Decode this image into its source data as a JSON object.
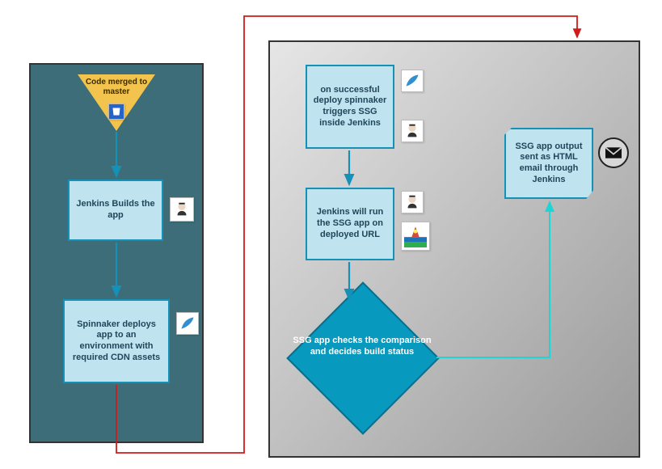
{
  "chart_data": {
    "type": "flowchart",
    "panels": [
      {
        "id": "panel-left",
        "bounds": [
          36,
          78,
          216,
          470
        ]
      },
      {
        "id": "panel-right",
        "bounds": [
          332,
          50,
          460,
          516
        ]
      }
    ],
    "nodes": [
      {
        "id": "merge",
        "shape": "triangle",
        "panel": "left",
        "label": "Code merged to master",
        "icon": "bitbucket"
      },
      {
        "id": "jenkins1",
        "shape": "rect",
        "panel": "left",
        "label": "Jenkins Builds the app",
        "icon": "jenkins"
      },
      {
        "id": "spinnaker",
        "shape": "rect",
        "panel": "left",
        "label": "Spinnaker deploys app to an environment with required CDN assets",
        "icon": "spinnaker"
      },
      {
        "id": "trigger",
        "shape": "rect",
        "panel": "right",
        "label": "on successful deploy spinnaker triggers SSG inside Jenkins",
        "icons": [
          "spinnaker",
          "jenkins"
        ]
      },
      {
        "id": "run",
        "shape": "rect",
        "panel": "right",
        "label": "Jenkins will run the SSG app on deployed URL",
        "icons": [
          "jenkins",
          "lighthouse"
        ]
      },
      {
        "id": "check",
        "shape": "diamond",
        "panel": "right",
        "label": "SSG app checks the comparison and decides build status"
      },
      {
        "id": "email",
        "shape": "note",
        "panel": "right",
        "label": "SSG app output sent as HTML email through Jenkins",
        "icon": "email"
      }
    ],
    "edges": [
      {
        "from": "merge",
        "to": "jenkins1",
        "color": "#1590b6"
      },
      {
        "from": "jenkins1",
        "to": "spinnaker",
        "color": "#1590b6"
      },
      {
        "from": "spinnaker",
        "to": "trigger",
        "color": "#d11a1a",
        "routed": true
      },
      {
        "from": "trigger",
        "to": "run",
        "color": "#1590b6"
      },
      {
        "from": "run",
        "to": "check",
        "color": "#1590b6"
      },
      {
        "from": "check",
        "to": "email",
        "color": "#1fd4d4"
      }
    ]
  },
  "left": {
    "merge_label": "Code merged to master",
    "jenkins_label": "Jenkins Builds the app",
    "spinnaker_label": "Spinnaker deploys app to an environment with required CDN assets"
  },
  "right": {
    "trigger_label": "on successful deploy spinnaker triggers SSG inside Jenkins",
    "run_label": "Jenkins will run the SSG app on deployed URL",
    "check_label": "SSG app checks the comparison and decides build status",
    "email_label": "SSG app output sent as HTML email through Jenkins"
  },
  "icons": {
    "bitbucket": "bitbucket-icon",
    "jenkins": "jenkins-icon",
    "spinnaker": "spinnaker-icon",
    "lighthouse": "lighthouse-icon",
    "email": "email-icon"
  }
}
